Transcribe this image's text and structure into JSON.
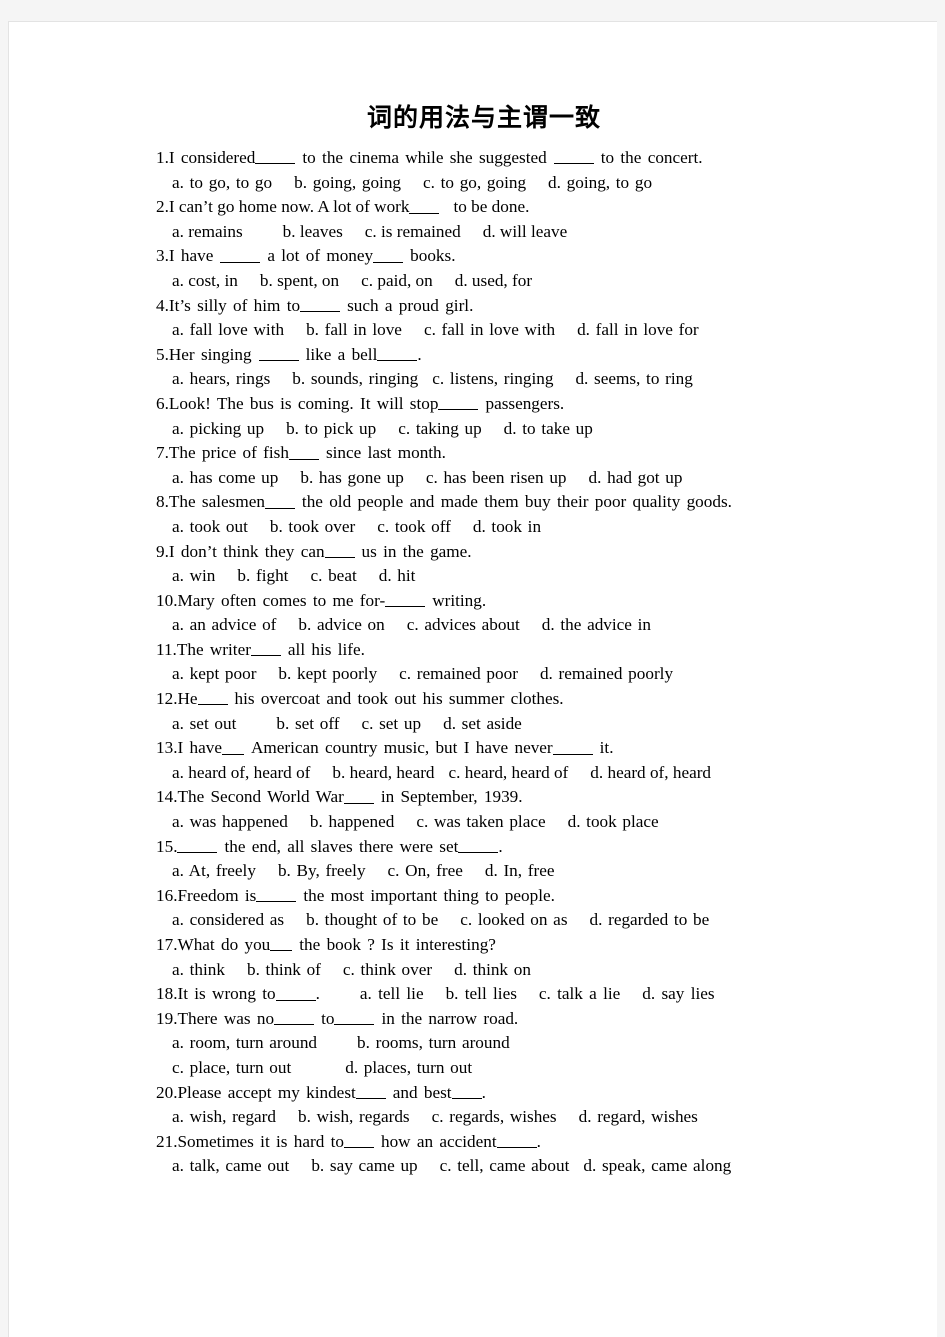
{
  "document": {
    "title": "词的用法与主谓一致",
    "page_background": "#ffffff",
    "canvas_background": "#f5f5f5",
    "text_color": "#000000"
  },
  "questions": [
    {
      "number": "1.",
      "stem_parts": [
        "I considered",
        "to the cinema while she suggested",
        "to the concert."
      ],
      "options": [
        "a. to go, to go",
        "b. going, going",
        "c. to go, going",
        "d. going, to go"
      ],
      "option_rows": 1
    },
    {
      "number": "2.",
      "stem_parts": [
        "I can’t go home now. A lot of work",
        "to be done."
      ],
      "options": [
        "a. remains",
        "b. leaves",
        "c. is remained",
        "d. will leave"
      ],
      "option_rows": 1
    },
    {
      "number": "3.",
      "stem_parts": [
        "I have",
        "a lot of money",
        "books."
      ],
      "options": [
        "a. cost, in",
        "b. spent, on",
        "c. paid, on",
        "d. used, for"
      ],
      "option_rows": 1
    },
    {
      "number": "4.",
      "stem_parts": [
        "It’s silly of him to",
        "such a proud girl."
      ],
      "options": [
        "a. fall love with",
        "b. fall in love",
        "c. fall in love with",
        "d. fall in love for"
      ],
      "option_rows": 1
    },
    {
      "number": "5.",
      "stem_parts": [
        "Her singing",
        "like a bell",
        "."
      ],
      "options": [
        "a. hears, rings",
        "b. sounds, ringing",
        "c. listens, ringing",
        "d. seems, to ring"
      ],
      "option_rows": 1
    },
    {
      "number": "6.",
      "stem_parts": [
        "Look! The bus is coming. It will stop",
        "passengers."
      ],
      "options": [
        "a. picking up",
        "b. to pick up",
        "c. taking up",
        "d. to take up"
      ],
      "option_rows": 1
    },
    {
      "number": "7.",
      "stem_parts": [
        "The price of fish",
        "since last month."
      ],
      "options": [
        "a. has come up",
        "b. has gone up",
        "c. has been risen up",
        "d. had got up"
      ],
      "option_rows": 1
    },
    {
      "number": "8.",
      "stem_parts": [
        "The salesmen",
        "the old people and made them buy their poor quality goods."
      ],
      "options": [
        "a. took out",
        "b. took over",
        "c. took off",
        "d. took in"
      ],
      "option_rows": 1
    },
    {
      "number": "9.",
      "stem_parts": [
        "I don’t think they can",
        "us in the game."
      ],
      "options": [
        "a. win",
        "b. fight",
        "c. beat",
        "d. hit"
      ],
      "option_rows": 1
    },
    {
      "number": "10.",
      "stem_parts": [
        "Mary often comes to me for-",
        "writing."
      ],
      "options": [
        "a. an advice of",
        "b. advice on",
        "c. advices about",
        "d. the advice in"
      ],
      "option_rows": 1
    },
    {
      "number": "11.",
      "stem_parts": [
        "The writer",
        "all his life."
      ],
      "options": [
        "a. kept poor",
        "b. kept poorly",
        "c. remained poor",
        "d. remained poorly"
      ],
      "option_rows": 1
    },
    {
      "number": "12.",
      "stem_parts": [
        "He",
        "his overcoat and took out his summer clothes."
      ],
      "options": [
        "a. set out",
        "b. set off",
        "c. set up",
        "d. set aside"
      ],
      "option_rows": 1
    },
    {
      "number": "13.",
      "stem_parts": [
        "I have",
        "American country music, but I have never",
        "it."
      ],
      "options": [
        "a. heard of, heard of",
        "b. heard, heard",
        "c. heard, heard of",
        "d. heard of, heard"
      ],
      "option_rows": 1
    },
    {
      "number": "14.",
      "stem_parts": [
        "The Second World War",
        "in September, 1939."
      ],
      "options": [
        "a. was happened",
        "b. happened",
        "c. was taken place",
        "d. took place"
      ],
      "option_rows": 1
    },
    {
      "number": "15.",
      "stem_parts": [
        "",
        "the end, all slaves there were set",
        "."
      ],
      "options": [
        "a. At, freely",
        "b. By, freely",
        "c. On, free",
        "d. In, free"
      ],
      "option_rows": 1
    },
    {
      "number": "16.",
      "stem_parts": [
        "Freedom is",
        "the most important thing to people."
      ],
      "options": [
        "a. considered as",
        "b. thought of to be",
        "c. looked on as",
        "d. regarded to be"
      ],
      "option_rows": 1
    },
    {
      "number": "17.",
      "stem_parts": [
        "What do you",
        "the book ? Is it interesting?"
      ],
      "options": [
        "a. think",
        "b. think of",
        "c. think over",
        "d. think on"
      ],
      "option_rows": 1
    },
    {
      "number": "18.",
      "stem_parts": [
        "It is wrong to",
        "."
      ],
      "options": [
        "a. tell lie",
        "b. tell lies",
        "c. talk a lie",
        "d. say lies"
      ],
      "option_rows": 0,
      "inline_options": true
    },
    {
      "number": "19.",
      "stem_parts": [
        "There was no",
        "to",
        "in the narrow road."
      ],
      "options": [
        "a. room, turn around",
        "b. rooms, turn around",
        "c. place, turn out",
        "d. places, turn out"
      ],
      "option_rows": 2
    },
    {
      "number": "20.",
      "stem_parts": [
        "Please accept my kindest",
        "and best",
        "."
      ],
      "options": [
        "a. wish, regard",
        "b. wish, regards",
        "c. regards, wishes",
        "d. regard, wishes"
      ],
      "option_rows": 1
    },
    {
      "number": "21.",
      "stem_parts": [
        "Sometimes it is hard to",
        "how an accident",
        "."
      ],
      "options": [
        "a. talk, came out",
        "b. say came up",
        "c. tell, came about",
        "d. speak, came along"
      ],
      "option_rows": 1
    }
  ]
}
